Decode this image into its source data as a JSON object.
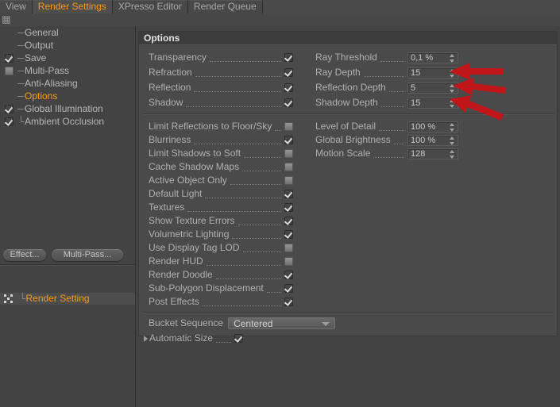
{
  "window": {
    "tabs": [
      {
        "label": "View",
        "active": false
      },
      {
        "label": "Render Settings",
        "active": true
      },
      {
        "label": "XPresso Editor",
        "active": false
      },
      {
        "label": "Render Queue",
        "active": false
      }
    ]
  },
  "tree": [
    {
      "label": "General",
      "checkbox": "none",
      "selected": false
    },
    {
      "label": "Output",
      "checkbox": "none",
      "selected": false
    },
    {
      "label": "Save",
      "checkbox": "checked",
      "selected": false
    },
    {
      "label": "Multi-Pass",
      "checkbox": "unchecked",
      "selected": false
    },
    {
      "label": "Anti-Aliasing",
      "checkbox": "none",
      "selected": false
    },
    {
      "label": "Options",
      "checkbox": "none",
      "selected": true
    },
    {
      "label": "Global Illumination",
      "checkbox": "checked",
      "selected": false
    },
    {
      "label": "Ambient Occlusion",
      "checkbox": "checked",
      "selected": false
    }
  ],
  "buttons": {
    "effect": "Effect...",
    "multipass": "Multi-Pass..."
  },
  "object": {
    "label": "Render Setting"
  },
  "options": {
    "title": "Options",
    "group1_left": [
      {
        "label": "Transparency",
        "checked": true
      },
      {
        "label": "Refraction",
        "checked": true
      },
      {
        "label": "Reflection",
        "checked": true
      },
      {
        "label": "Shadow",
        "checked": true
      }
    ],
    "group1_right": [
      {
        "label": "Ray Threshold",
        "value": "0,1 %"
      },
      {
        "label": "Ray Depth",
        "value": "15"
      },
      {
        "label": "Reflection Depth",
        "value": "5"
      },
      {
        "label": "Shadow Depth",
        "value": "15"
      }
    ],
    "group2_left": [
      {
        "label": "Limit Reflections to Floor/Sky",
        "checked": false
      },
      {
        "label": "Blurriness",
        "checked": true
      },
      {
        "label": "Limit Shadows to Soft",
        "checked": false
      },
      {
        "label": "Cache Shadow Maps",
        "checked": false
      },
      {
        "label": "Active Object Only",
        "checked": false
      },
      {
        "label": "Default Light",
        "checked": true
      },
      {
        "label": "Textures",
        "checked": true
      },
      {
        "label": "Show Texture Errors",
        "checked": true
      },
      {
        "label": "Volumetric Lighting",
        "checked": true
      },
      {
        "label": "Use Display Tag LOD",
        "checked": false
      },
      {
        "label": "Render HUD",
        "checked": false
      },
      {
        "label": "Render Doodle",
        "checked": true
      },
      {
        "label": "Sub-Polygon Displacement",
        "checked": true
      },
      {
        "label": "Post Effects",
        "checked": true
      }
    ],
    "group2_right": [
      {
        "label": "Level of Detail",
        "value": "100 %"
      },
      {
        "label": "Global Brightness",
        "value": "100 %"
      },
      {
        "label": "Motion Scale",
        "value": "128"
      }
    ],
    "bucket": {
      "label": "Bucket Sequence",
      "value": "Centered",
      "options": [
        "Centered"
      ]
    },
    "automatic_size": {
      "label": "Automatic Size",
      "checked": true
    }
  },
  "annotations": {
    "arrow_color": "#c0161a",
    "arrows": [
      {
        "target": "Ray Depth"
      },
      {
        "target": "Reflection Depth"
      },
      {
        "target": "Shadow Depth"
      }
    ]
  },
  "colors": {
    "accent": "#f59b1d",
    "panel": "#434343",
    "panel_light": "#4a4a4a",
    "header": "#3c3c3c",
    "text": "#b0b0b0"
  }
}
